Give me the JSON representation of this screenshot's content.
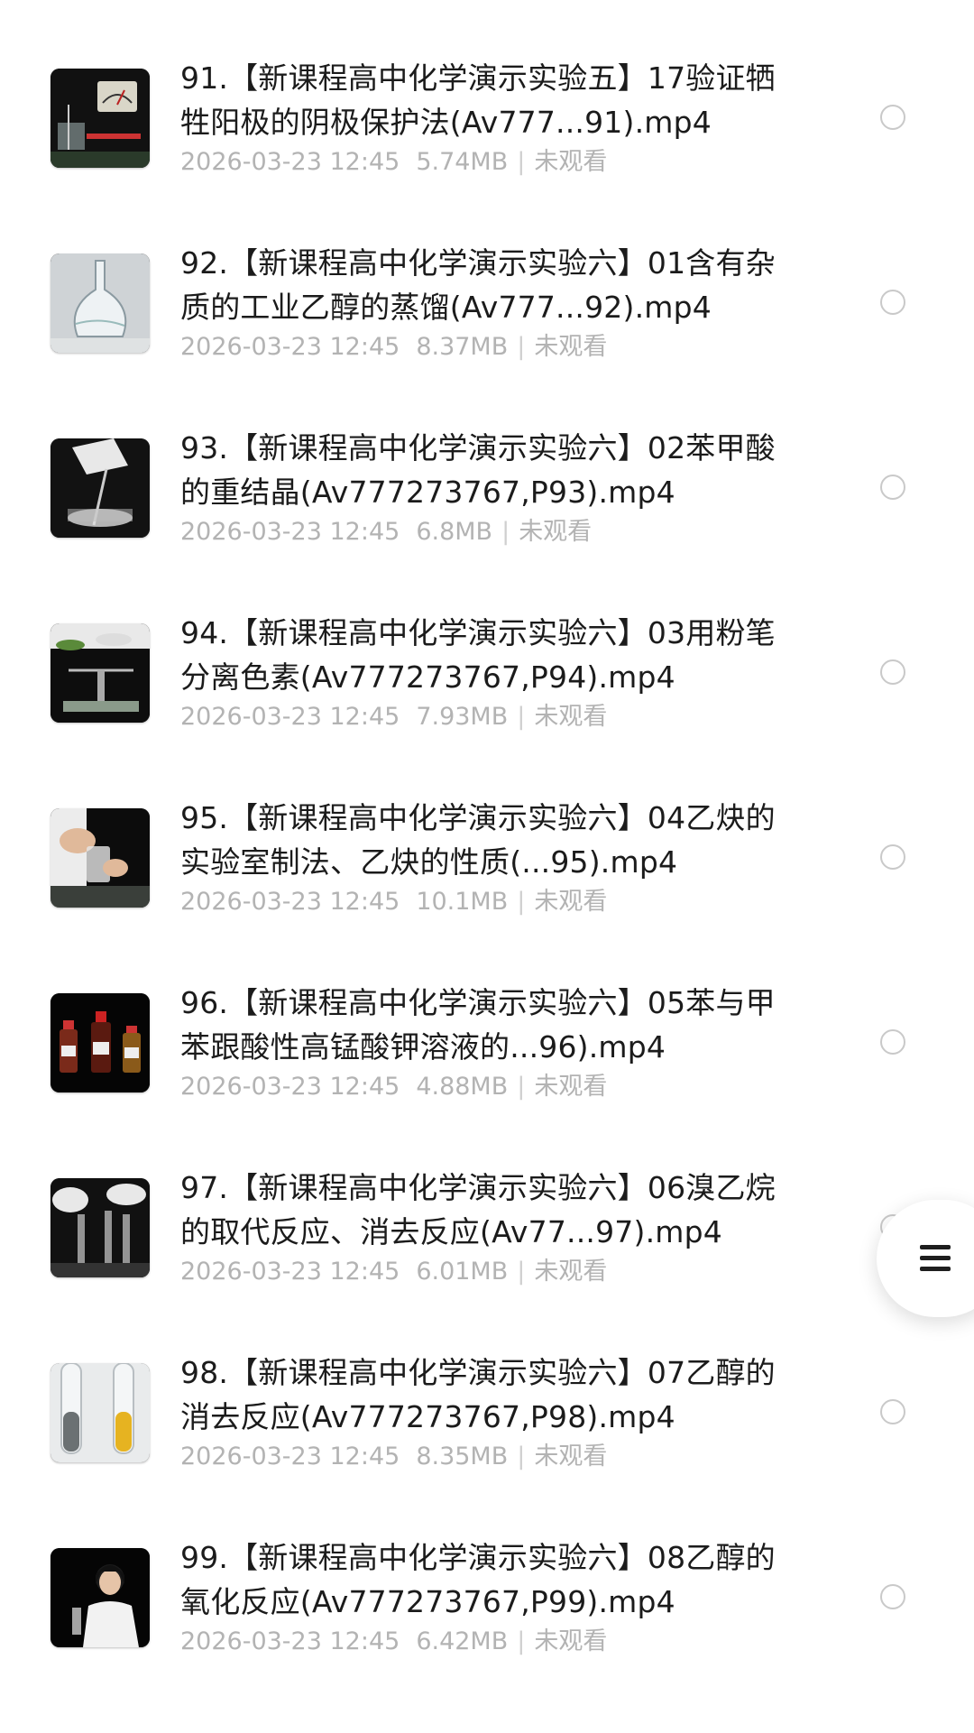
{
  "videos": [
    {
      "title": "91.【新课程高中化学演示实验五】17验证牺牲阳极的阴极保护法(Av777...91).mp4",
      "date": "2026-03-23 12:45",
      "size": "5.74MB",
      "status": "未观看",
      "thumb": "meter"
    },
    {
      "title": "92.【新课程高中化学演示实验六】01含有杂质的工业乙醇的蒸馏(Av777...92).mp4",
      "date": "2026-03-23 12:45",
      "size": "8.37MB",
      "status": "未观看",
      "thumb": "flask"
    },
    {
      "title": "93.【新课程高中化学演示实验六】02苯甲酸的重结晶(Av777273767,P93).mp4",
      "date": "2026-03-23 12:45",
      "size": "6.8MB",
      "status": "未观看",
      "thumb": "beaker"
    },
    {
      "title": "94.【新课程高中化学演示实验六】03用粉笔分离色素(Av777273767,P94).mp4",
      "date": "2026-03-23 12:45",
      "size": "7.93MB",
      "status": "未观看",
      "thumb": "balance"
    },
    {
      "title": "95.【新课程高中化学演示实验六】04乙炔的实验室制法、乙炔的性质(...95).mp4",
      "date": "2026-03-23 12:45",
      "size": "10.1MB",
      "status": "未观看",
      "thumb": "hands"
    },
    {
      "title": "96.【新课程高中化学演示实验六】05苯与甲苯跟酸性高锰酸钾溶液的...96).mp4",
      "date": "2026-03-23 12:45",
      "size": "4.88MB",
      "status": "未观看",
      "thumb": "bottles"
    },
    {
      "title": "97.【新课程高中化学演示实验六】06溴乙烷的取代反应、消去反应(Av77...97).mp4",
      "date": "2026-03-23 12:45",
      "size": "6.01MB",
      "status": "未观看",
      "thumb": "tubes-dark"
    },
    {
      "title": "98.【新课程高中化学演示实验六】07乙醇的消去反应(Av777273767,P98).mp4",
      "date": "2026-03-23 12:45",
      "size": "8.35MB",
      "status": "未观看",
      "thumb": "tubes-light"
    },
    {
      "title": "99.【新课程高中化学演示实验六】08乙醇的氧化反应(Av777273767,P99).mp4",
      "date": "2026-03-23 12:45",
      "size": "6.42MB",
      "status": "未观看",
      "thumb": "person"
    }
  ],
  "float_menu": {
    "icon": "menu-icon"
  }
}
